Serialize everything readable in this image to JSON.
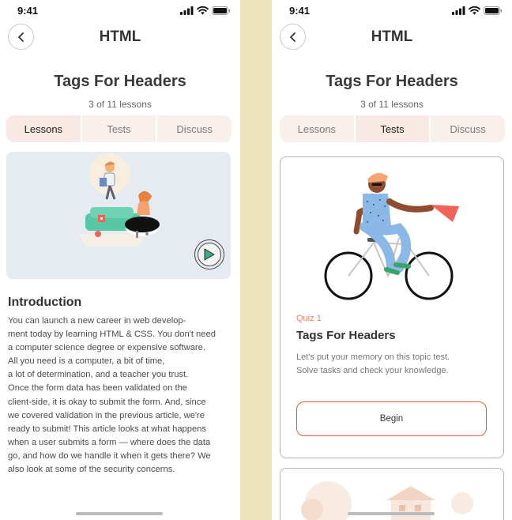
{
  "status": {
    "time": "9:41"
  },
  "header": {
    "title": "HTML"
  },
  "course": {
    "title": "Tags For Headers",
    "progress": "3 of 11 lessons"
  },
  "tabs": [
    {
      "label": "Lessons"
    },
    {
      "label": "Tests"
    },
    {
      "label": "Discuss"
    }
  ],
  "left_screen": {
    "active_tab": "Lessons",
    "section_title": "Introduction",
    "body_lines": [
      "You can launch a new career in web develop-",
      "ment today by learning HTML & CSS. You don't need",
      "a computer science degree or expensive software.",
      "All you need is a computer, a bit of time,",
      "a lot of determination, and a teacher you trust.",
      "Once the form data has been validated on the",
      "client-side, it is okay to submit the form. And, since",
      "we covered validation in the previous article, we're",
      "ready to submit! This article looks at what happens",
      "when a user submits a form — where does the data",
      "go, and how do we handle it when it gets there? We",
      "also look at some of the security concerns."
    ]
  },
  "right_screen": {
    "active_tab": "Tests",
    "quiz": {
      "label": "Quiz 1",
      "title": "Tags For Headers",
      "desc_lines": [
        "Let's put your memory on this topic test.",
        "Solve tasks and check your knowledge."
      ],
      "button": "Begin"
    }
  },
  "colors": {
    "background": "#ede3bd",
    "accent": "#e05a40",
    "tab_bg": "#faf0eb",
    "video_bg": "#e6ebf2"
  },
  "icons": [
    "back-arrow-icon",
    "signal-icon",
    "wifi-icon",
    "battery-icon",
    "play-icon"
  ]
}
